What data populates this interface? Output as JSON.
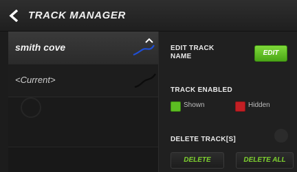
{
  "header": {
    "title": "TRACK MANAGER",
    "back_icon": "chevron-left-icon"
  },
  "tracks": [
    {
      "name": "smith cove",
      "selected": true,
      "thumb_color": "#1f4fd6",
      "indicator_icon": "chevron-up-icon"
    },
    {
      "name": "<Current>",
      "selected": false,
      "thumb_color": "#111111"
    }
  ],
  "edit": {
    "label": "EDIT TRACK NAME",
    "button": "EDIT"
  },
  "enabled": {
    "label": "TRACK ENABLED",
    "shown_label": "Shown",
    "hidden_label": "Hidden",
    "shown_color": "#5cbd22",
    "hidden_color": "#c21f24"
  },
  "delete": {
    "label": "DELETE TRACK[S]",
    "delete_button": "DELETE",
    "delete_all_button": "DELETE ALL"
  },
  "colors": {
    "accent_green": "#7ed12f",
    "background": "#1c1c1c"
  }
}
